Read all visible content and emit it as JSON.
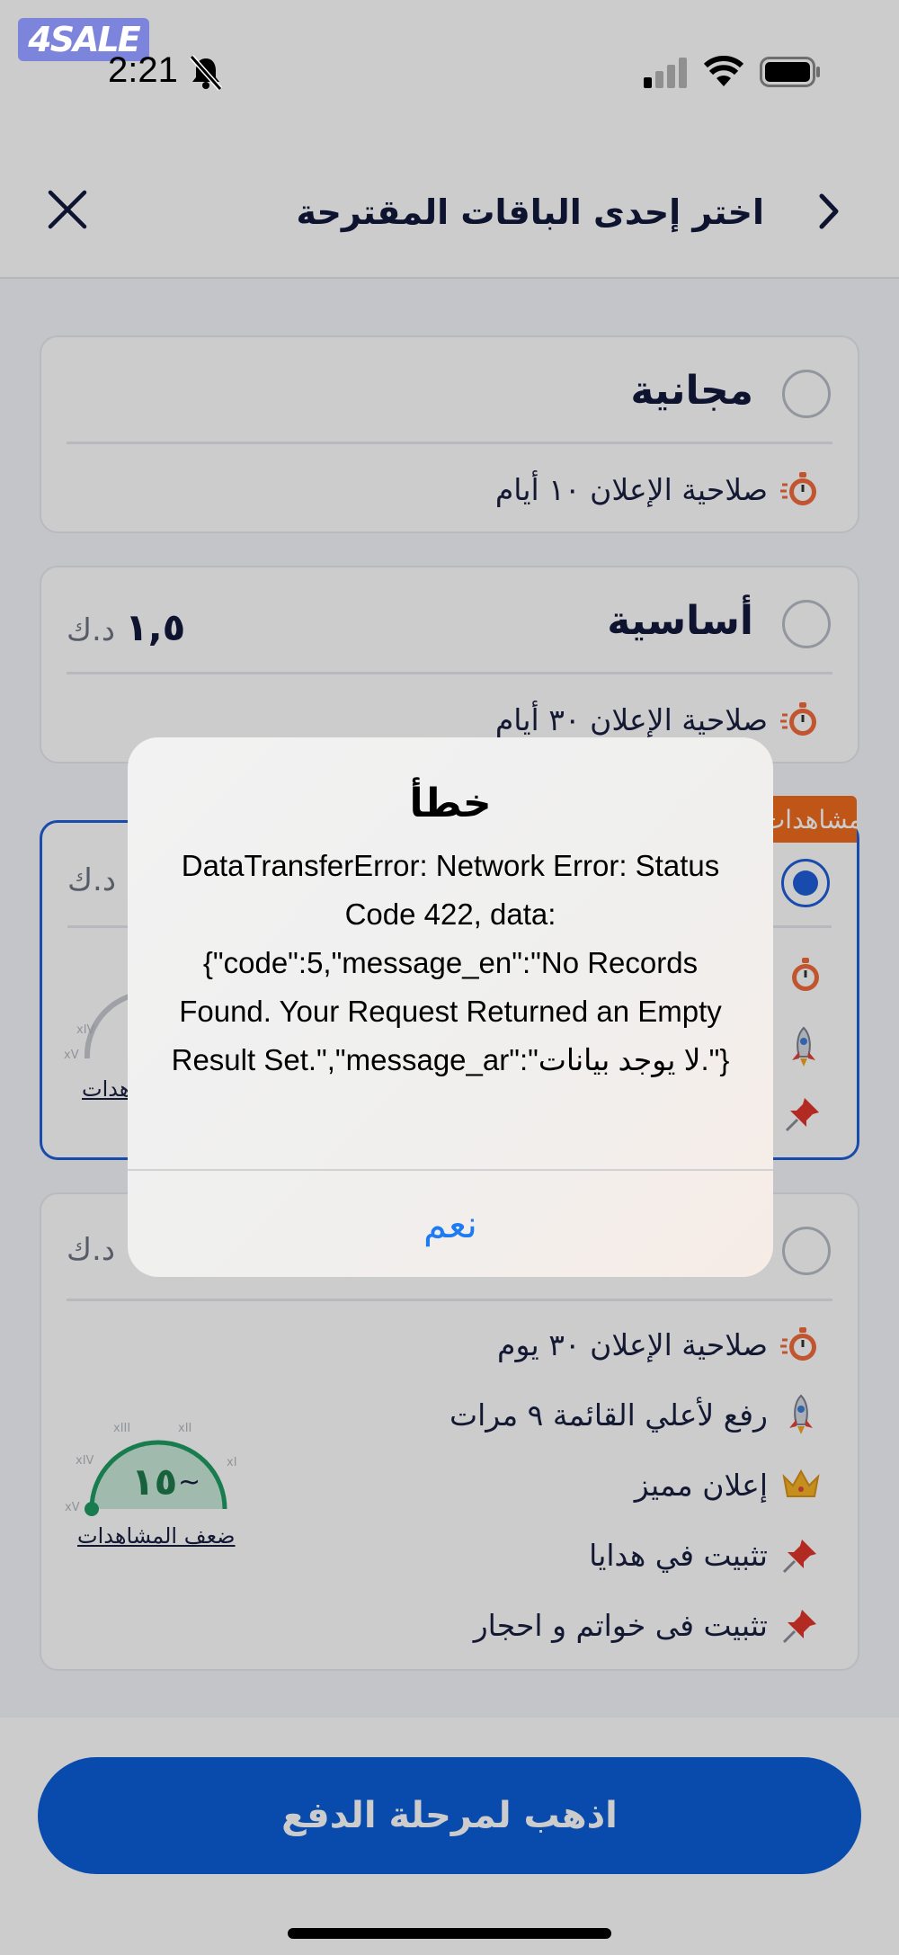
{
  "status_bar": {
    "time": "2:21",
    "watermark": "4SALE"
  },
  "header": {
    "title": "اختر إحدى الباقات المقترحة"
  },
  "packages": [
    {
      "name": "مجانية",
      "price": "",
      "currency": "",
      "selected": false,
      "features": [
        {
          "icon": "stopwatch-icon",
          "label": "صلاحية الإعلان ١٠ أيام"
        }
      ]
    },
    {
      "name": "أساسية",
      "price": "١,٥",
      "currency": "د.ك",
      "selected": false,
      "features": [
        {
          "icon": "stopwatch-icon",
          "label": "صلاحية الإعلان ٣٠ أيام"
        }
      ]
    },
    {
      "name": "",
      "price": "",
      "currency": "د.ك",
      "selected": true,
      "badge": "مشاهدات",
      "gauge_caption": "هدات"
    },
    {
      "name": "",
      "price": "",
      "currency": "د.ك",
      "selected": false,
      "features": [
        {
          "icon": "stopwatch-icon",
          "label": "صلاحية الإعلان ٣٠ يوم"
        },
        {
          "icon": "rocket-icon",
          "label": "رفع لأعلي القائمة ٩ مرات"
        },
        {
          "icon": "crown-icon",
          "label": "إعلان مميز"
        },
        {
          "icon": "pin-icon",
          "label": "تثبيت في هدايا"
        },
        {
          "icon": "pin-icon",
          "label": "تثبيت فى خواتم و احجار"
        }
      ],
      "gauge": {
        "value": "١٥",
        "prefix": "~",
        "caption": "ضعف المشاهدات",
        "ticks": [
          "xV",
          "xIV",
          "xIII",
          "xII",
          "xI"
        ]
      }
    }
  ],
  "footer": {
    "pay_button": "اذهب لمرحلة الدفع"
  },
  "alert": {
    "title": "خطأ",
    "message": "DataTransferError: Network Error: Status Code 422, data: {\"code\":5,\"message_en\":\"No Records Found. Your Request Returned an Empty Result Set.\",\"message_ar\":\"لا يوجد بيانات.\"}",
    "button": "نعم"
  },
  "colors": {
    "primary": "#0a5ed9",
    "selected_border": "#1f5ed8",
    "badge": "#ef6b1c",
    "gauge_green": "#1e9b63",
    "alert_button": "#1e7bf2"
  }
}
